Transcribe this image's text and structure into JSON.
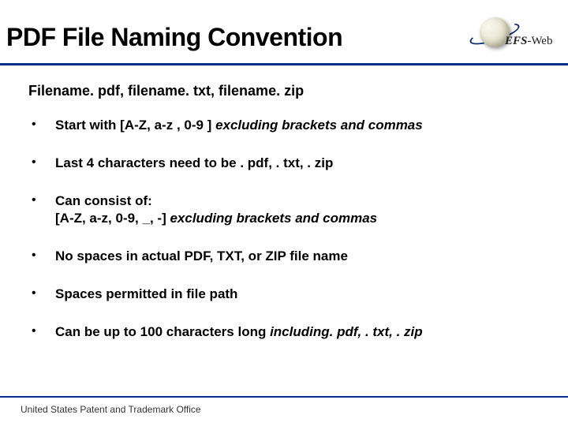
{
  "title": "PDF File Naming Convention",
  "logo": {
    "text_efs": "EFS",
    "text_web": "-Web"
  },
  "subtitle": "Filename. pdf, filename. txt, filename. zip",
  "bullets": [
    {
      "pre": "Start with [A-Z, a-z , 0-9 ] ",
      "ital": "excluding brackets and commas",
      "post": ""
    },
    {
      "pre": "Last 4 characters need to be . pdf, . txt, . zip",
      "ital": "",
      "post": ""
    },
    {
      "pre": "Can consist of:",
      "br": true,
      "pre2": "[A-Z, a-z, 0-9, _, -] ",
      "ital": "excluding brackets and commas",
      "post": ""
    },
    {
      "pre": "No spaces in actual PDF, TXT, or ZIP file name",
      "ital": "",
      "post": ""
    },
    {
      "pre": "Spaces permitted in file path",
      "ital": "",
      "post": ""
    },
    {
      "pre": "Can be up to 100 characters long ",
      "ital": "including. pdf, . txt, . zip",
      "post": ""
    }
  ],
  "footer": "United States Patent and Trademark Office"
}
